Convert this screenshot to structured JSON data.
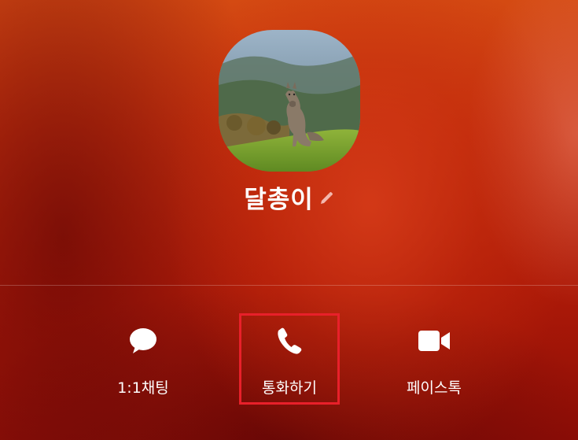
{
  "profile": {
    "name": "달총이",
    "photo_alt": "profile-photo"
  },
  "actions": [
    {
      "label": "1:1채팅",
      "icon": "chat-bubble-icon"
    },
    {
      "label": "통화하기",
      "icon": "phone-icon",
      "highlighted": true,
      "highlight_color": "#e8202a"
    },
    {
      "label": "페이스톡",
      "icon": "video-camera-icon"
    }
  ],
  "colors": {
    "background_top": "#d44a12",
    "background_bottom": "#8e0d06",
    "text": "#ffffff",
    "highlight": "#e8202a"
  }
}
